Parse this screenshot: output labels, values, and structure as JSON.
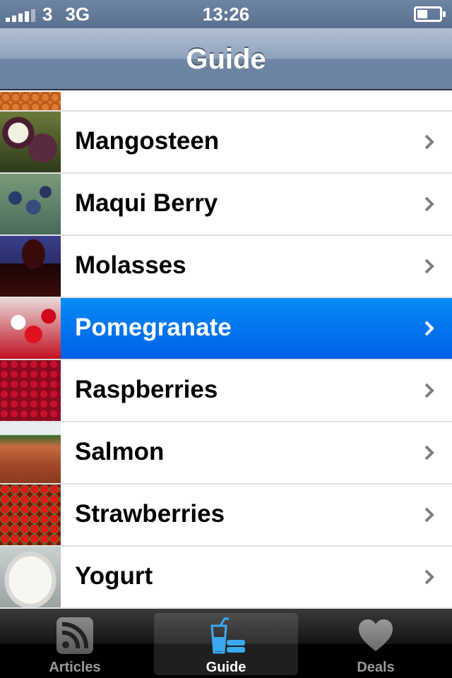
{
  "status_bar": {
    "carrier": "3",
    "network": "3G",
    "time": "13:26"
  },
  "nav": {
    "title": "Guide"
  },
  "list": {
    "items": [
      {
        "label": "Mangosteen",
        "selected": false
      },
      {
        "label": "Maqui Berry",
        "selected": false
      },
      {
        "label": "Molasses",
        "selected": false
      },
      {
        "label": "Pomegranate",
        "selected": true
      },
      {
        "label": "Raspberries",
        "selected": false
      },
      {
        "label": "Salmon",
        "selected": false
      },
      {
        "label": "Strawberries",
        "selected": false
      },
      {
        "label": "Yogurt",
        "selected": false
      }
    ]
  },
  "tab_bar": {
    "tabs": [
      {
        "label": "Articles",
        "icon": "rss-icon",
        "active": false
      },
      {
        "label": "Guide",
        "icon": "guide-drink-icon",
        "active": true
      },
      {
        "label": "Deals",
        "icon": "heart-icon",
        "active": false
      }
    ]
  },
  "colors": {
    "selected_row": "#0a74ee",
    "nav_bar": "#6d84a3",
    "tab_bar": "#000000"
  }
}
